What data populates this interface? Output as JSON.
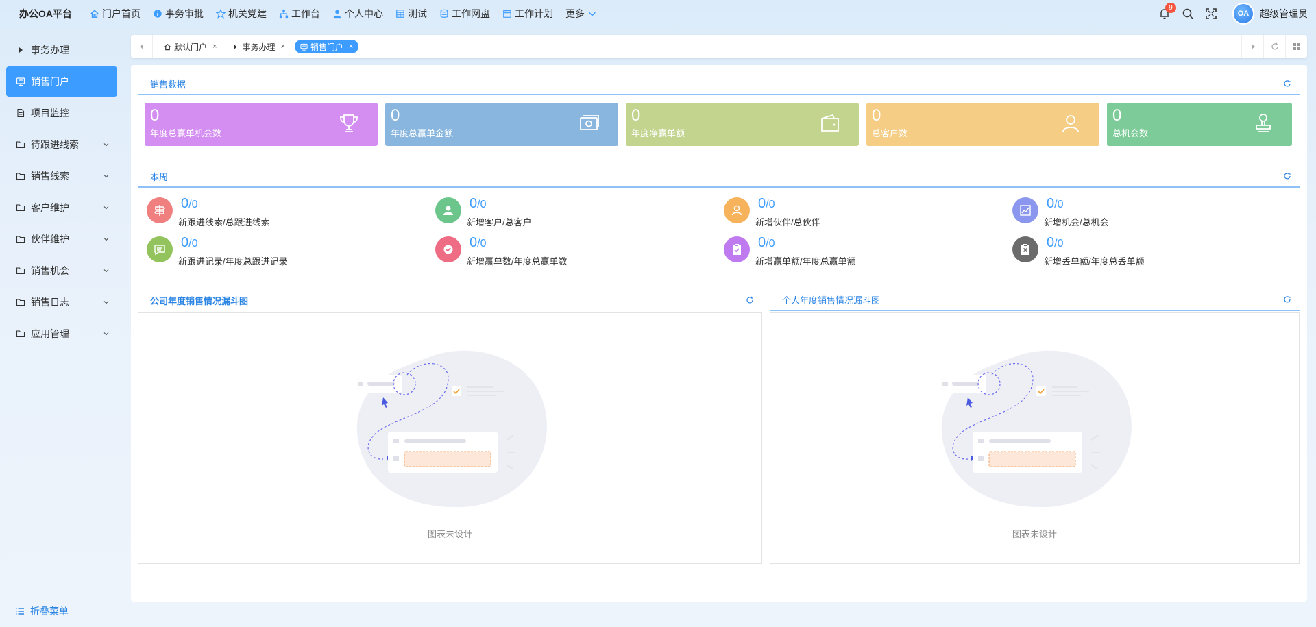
{
  "brand": "办公OA平台",
  "nav": [
    {
      "label": "门户首页",
      "icon": "home-icon"
    },
    {
      "label": "事务审批",
      "icon": "info-circle-icon"
    },
    {
      "label": "机关党建",
      "icon": "star-icon"
    },
    {
      "label": "工作台",
      "icon": "sitemap-icon"
    },
    {
      "label": "个人中心",
      "icon": "user-icon"
    },
    {
      "label": "测试",
      "icon": "grid-icon"
    },
    {
      "label": "工作网盘",
      "icon": "database-icon"
    },
    {
      "label": "工作计划",
      "icon": "calendar-icon"
    },
    {
      "label": "更多",
      "icon": "chevron-down-icon"
    }
  ],
  "topright": {
    "badge": "9",
    "avatar_text": "OA",
    "username": "超级管理员"
  },
  "sidebar": [
    {
      "label": "事务办理",
      "icon": "caret-right-icon"
    },
    {
      "label": "销售门户",
      "icon": "store-icon"
    },
    {
      "label": "项目监控",
      "icon": "file-icon"
    },
    {
      "label": "待跟进线索",
      "icon": "folder-icon"
    },
    {
      "label": "销售线索",
      "icon": "folder-icon"
    },
    {
      "label": "客户维护",
      "icon": "folder-icon"
    },
    {
      "label": "伙伴维护",
      "icon": "folder-icon"
    },
    {
      "label": "销售机会",
      "icon": "folder-icon"
    },
    {
      "label": "销售日志",
      "icon": "folder-icon"
    },
    {
      "label": "应用管理",
      "icon": "folder-icon"
    }
  ],
  "collapse_label": "折叠菜单",
  "tabs": [
    {
      "label": "默认门户",
      "close": "×"
    },
    {
      "label": "事务办理",
      "close": "×"
    },
    {
      "label": "销售门户",
      "close": "×"
    }
  ],
  "sections": {
    "sales": "销售数据",
    "week": "本周",
    "company_funnel": "公司年度销售情况漏斗图",
    "personal_funnel": "个人年度销售情况漏斗图"
  },
  "cards": [
    {
      "value": "0",
      "label": "年度总赢单机会数",
      "color": "#d48ef2",
      "icon": "trophy-icon"
    },
    {
      "value": "0",
      "label": "年度总赢单金额",
      "color": "#88b6de",
      "icon": "money-icon"
    },
    {
      "value": "0",
      "label": "年度净赢单额",
      "color": "#c2d48e",
      "icon": "wallet-icon"
    },
    {
      "value": "0",
      "label": "总客户数",
      "color": "#f5cd85",
      "icon": "person-icon"
    },
    {
      "value": "0",
      "label": "总机会数",
      "color": "#7ccb98",
      "icon": "stamp-icon"
    }
  ],
  "week": [
    {
      "a": "0",
      "b": "0",
      "label": "新跟进线索/总跟进线索",
      "color": "#f07f7f",
      "icon": "signpost-icon"
    },
    {
      "a": "0",
      "b": "0",
      "label": "新增客户/总客户",
      "color": "#6cc68b",
      "icon": "customer-icon"
    },
    {
      "a": "0",
      "b": "0",
      "label": "新增伙伴/总伙伴",
      "color": "#f6b35c",
      "icon": "partner-icon"
    },
    {
      "a": "0",
      "b": "0",
      "label": "新增机会/总机会",
      "color": "#8b97ee",
      "icon": "trend-icon"
    },
    {
      "a": "0",
      "b": "0",
      "label": "新跟进记录/年度总跟进记录",
      "color": "#93c35c",
      "icon": "chat-icon"
    },
    {
      "a": "0",
      "b": "0",
      "label": "新增赢单数/年度总赢单数",
      "color": "#ee6d85",
      "icon": "check-badge-icon"
    },
    {
      "a": "0",
      "b": "0",
      "label": "新增赢单额/年度总赢单额",
      "color": "#c07af0",
      "icon": "clipboard-check-icon"
    },
    {
      "a": "0",
      "b": "0",
      "label": "新增丢单额/年度总丢单额",
      "color": "#6b6b6b",
      "icon": "clipboard-x-icon"
    }
  ],
  "empty_text": "图表未设计"
}
